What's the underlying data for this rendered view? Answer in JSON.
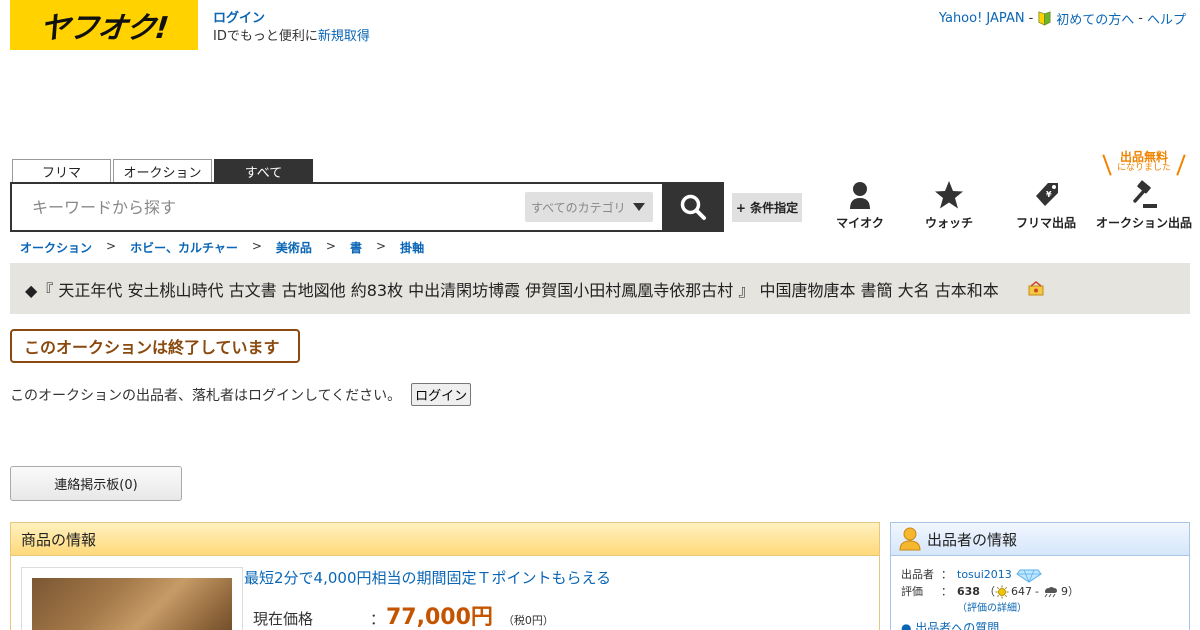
{
  "header": {
    "logo_text": "ヤフオク!",
    "login_link": "ログイン",
    "login_sub_prefix": "IDでもっと便利に",
    "register_link": "新規取得",
    "top_links": [
      "Yahoo! JAPAN",
      "初めての方へ",
      "ヘルプ"
    ],
    "top_sep": "-"
  },
  "search": {
    "tabs": [
      "フリマ",
      "オークション",
      "すべて"
    ],
    "active_tab": "すべて",
    "placeholder": "キーワードから探す",
    "category": "すべてのカテゴリ",
    "conditions_button": "+ 条件指定"
  },
  "nav": {
    "myauc": "マイオク",
    "watch": "ウォッチ",
    "flea_listing": "フリマ出品",
    "auction_listing": "オークション出品",
    "free_badge_main": "出品無料",
    "free_badge_sub": "になりました"
  },
  "breadcrumb": [
    "オークション",
    "ホビー、カルチャー",
    "美術品",
    "書",
    "掛軸"
  ],
  "breadcrumb_sep": ">",
  "item": {
    "title": "◆『 天正年代 安土桃山時代 古文書 古地図他 約83枚 中出清閑坊博霞 伊賀国小田村鳳凰寺依那古村 』 中国唐物唐本 書簡 大名 古本和本",
    "ended_message": "このオークションは終了しています",
    "login_notice": "このオークションの出品者、落札者はログインしてください。",
    "login_button": "ログイン",
    "board_button": "連絡掲示板(0)"
  },
  "product": {
    "header": "商品の情報",
    "promo": "最短2分で4,000円相当の期間固定Ｔポイントもらえる",
    "price_label": "現在価格",
    "price_colon": "：",
    "price_value": "77,000円",
    "price_tax": "（税0円）"
  },
  "seller": {
    "header": "出品者の情報",
    "name_label": "出品者",
    "colon": "：",
    "name": "tosui2013",
    "rating_label": "評価",
    "rating_total": "638",
    "rating_good": "647",
    "rating_bad": "9",
    "rating_open": "（",
    "rating_dash": "-",
    "rating_close": "）",
    "rating_detail": "（評価の詳細）",
    "cut_row": "● 出品者への質問"
  },
  "colors": {
    "yahoo_yellow": "#ffd200",
    "link_blue": "#0a66b5",
    "price_orange": "#c45400",
    "ended_brown": "#8a4a0f",
    "title_bg": "#e5e4df"
  }
}
